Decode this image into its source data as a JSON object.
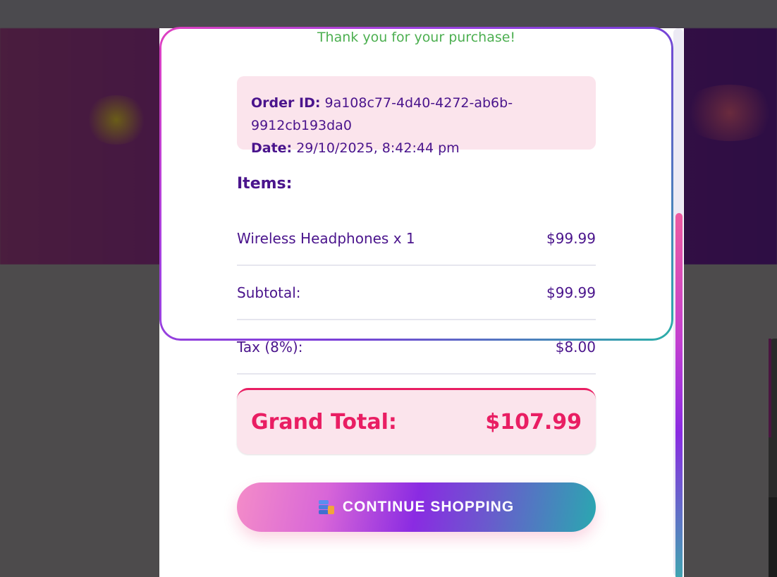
{
  "modal": {
    "thanks": "Thank you for your purchase!",
    "order": {
      "id_label": "Order ID:",
      "id_value": "9a108c77-4d40-4272-ab6b-9912cb193da0",
      "date_label": "Date:",
      "date_value": "29/10/2025, 8:42:44 pm"
    },
    "items_heading": "Items:",
    "items": [
      {
        "name": "Wireless Headphones x 1",
        "price": "$99.99"
      }
    ],
    "subtotal_label": "Subtotal:",
    "subtotal_value": "$99.99",
    "tax_label": "Tax (8%):",
    "tax_value": "$8.00",
    "grand_total_label": "Grand Total:",
    "grand_total_value": "$107.99",
    "continue_button": "CONTINUE SHOPPING",
    "continue_icon": "shopping-icon"
  },
  "colors": {
    "thanks_green": "#4caf50",
    "text_purple": "#4a148c",
    "total_pink": "#e91e63",
    "panel_pink": "#fbe4ec"
  }
}
